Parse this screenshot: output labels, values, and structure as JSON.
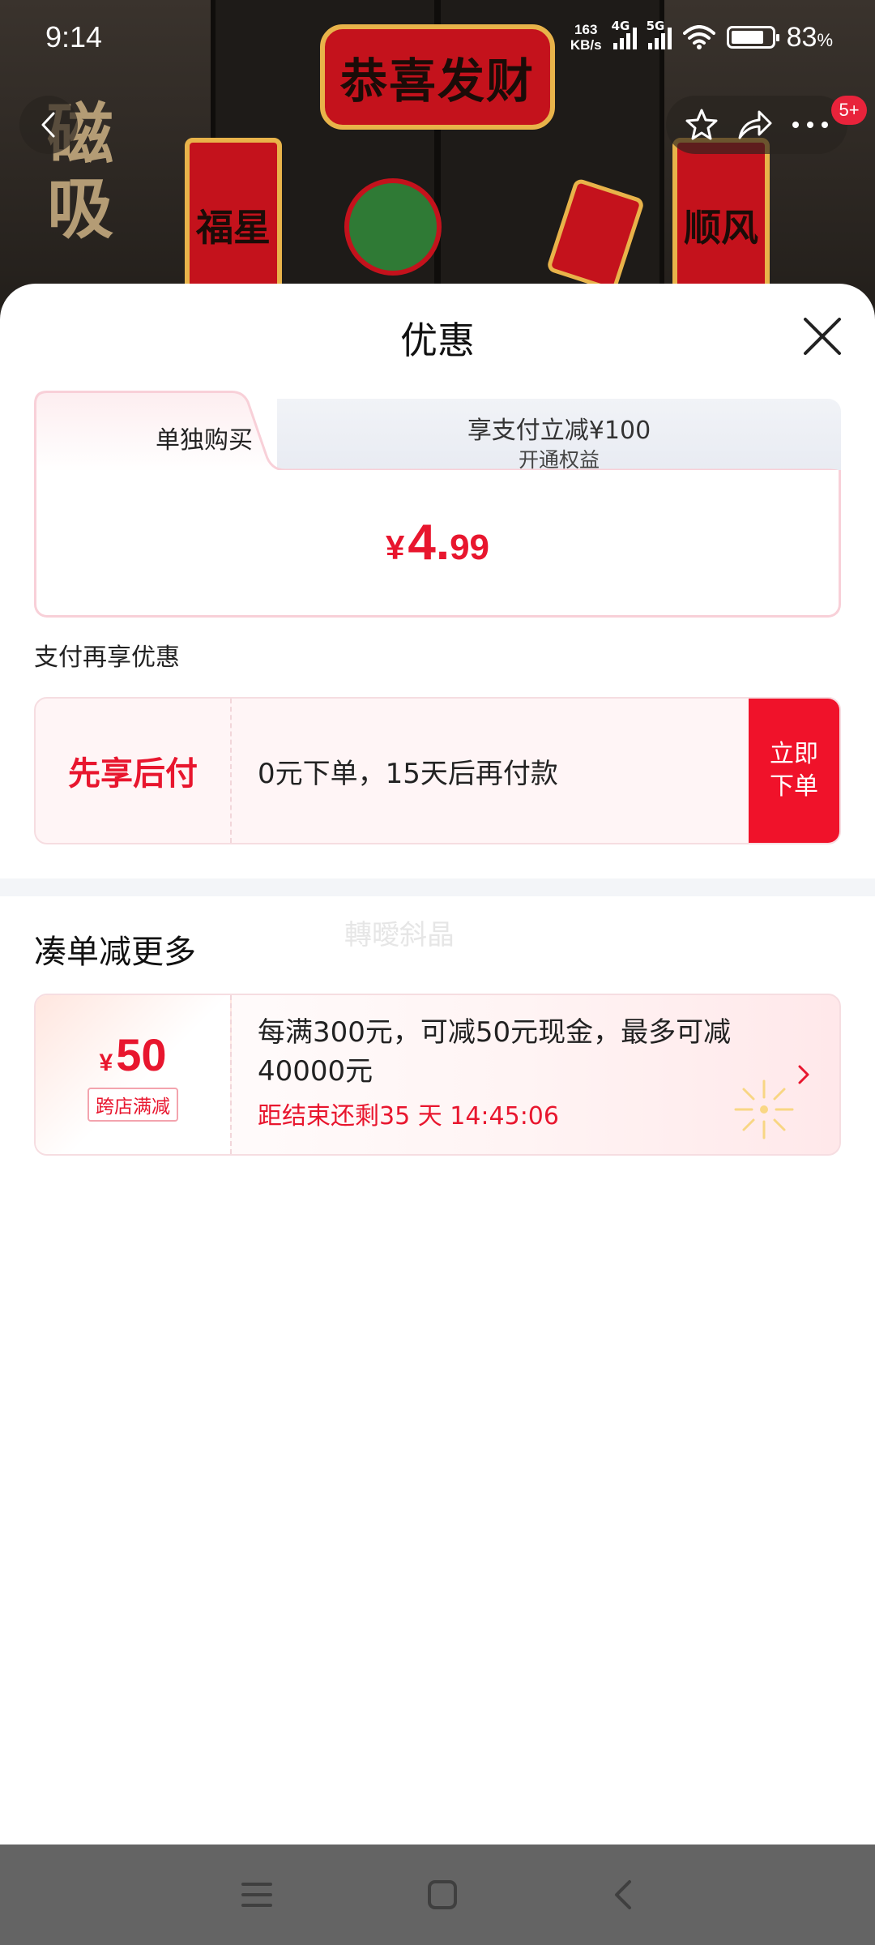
{
  "status_bar": {
    "time": "9:14",
    "net_speed_value": "163",
    "net_speed_unit": "KB/s",
    "signal_1": "4G",
    "signal_2": "5G",
    "battery_value": "83",
    "battery_unit": "%",
    "battery_level": 0.83
  },
  "product_image": {
    "banner_text": "恭喜发财",
    "scroll_left_text": "福星",
    "scroll_right_text": "顺风",
    "side_text": "磁吸"
  },
  "top_nav": {
    "back_icon": "chevron-left-icon",
    "favorite_icon": "star-icon",
    "share_icon": "share-icon",
    "more_icon": "more-icon",
    "badge": "5+"
  },
  "sheet": {
    "title": "优惠",
    "close_icon": "close-icon",
    "tabs": [
      {
        "label": "单独购买",
        "sub": "",
        "active": true
      },
      {
        "label": "享支付立减¥100",
        "sub": "开通权益",
        "active": false
      }
    ],
    "price": {
      "currency": "¥",
      "integer": "4.",
      "decimal": "99"
    },
    "pay_section_title": "支付再享优惠",
    "bnpl": {
      "name": "先享后付",
      "description": "0元下单，15天后再付款",
      "button_label": "立即下单"
    },
    "more_section_title": "凑单减更多",
    "watermark": "轉曖斜晶",
    "promo": {
      "currency": "¥",
      "amount": "50",
      "tag": "跨店满减",
      "text": "每满300元，可减50元现金，最多可减40000元",
      "countdown": "距结束还剩35 天 14:45:06"
    }
  },
  "system_nav": {
    "menu_icon": "menu-icon",
    "home_icon": "home-icon",
    "back_icon": "back-icon"
  },
  "colors": {
    "accent_red": "#e8162e",
    "button_red": "#f0122a",
    "pink_border": "#f8d0d8"
  }
}
